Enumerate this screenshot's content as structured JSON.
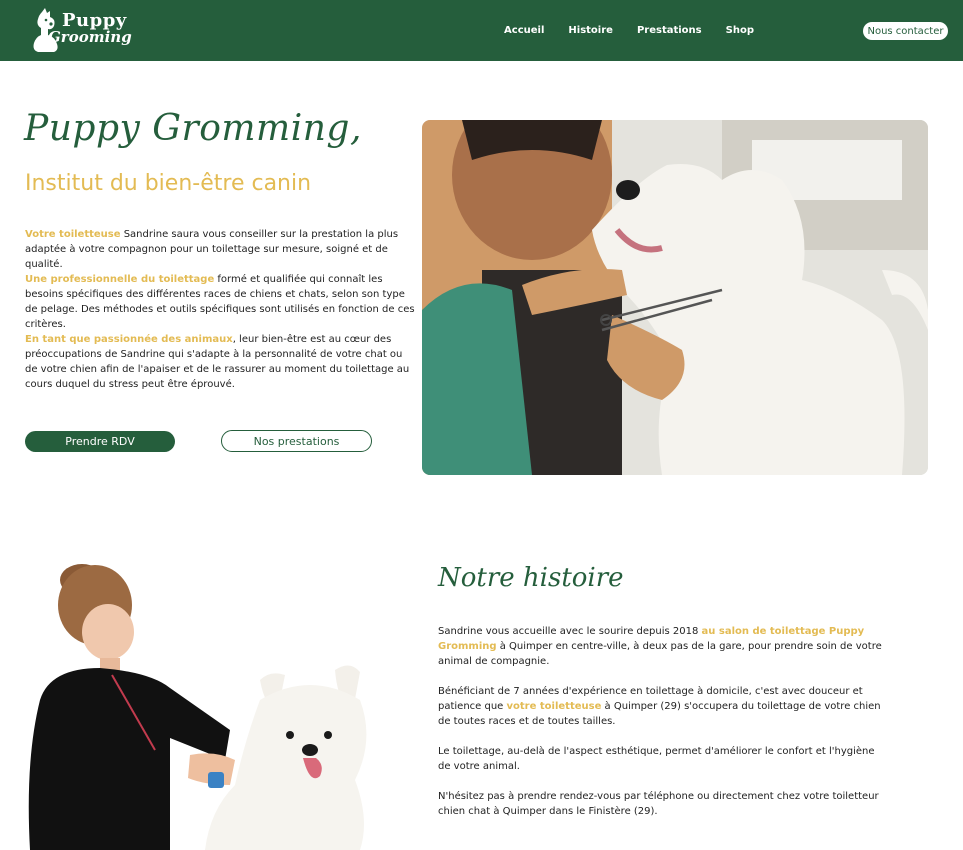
{
  "brand": {
    "name_top": "Puppy",
    "name_bottom": "Grooming"
  },
  "nav": {
    "links": [
      "Accueil",
      "Histoire",
      "Prestations",
      "Shop"
    ],
    "contact": "Nous contacter"
  },
  "hero": {
    "title": "Puppy Gromming,",
    "subtitle": "Institut du bien-être canin",
    "p1_hl": "Votre toiletteuse",
    "p1_rest": " Sandrine saura vous conseiller sur la prestation la plus adaptée à votre compagnon pour un toilettage sur mesure, soigné et de qualité.",
    "p2_hl": "Une professionnelle du toilettage",
    "p2_rest": " formé et qualifiée qui connaît les besoins spécifiques des différentes races de chiens et chats, selon son type de pelage. Des méthodes et outils spécifiques sont utilisés en fonction de ces critères.",
    "p3_hl": "En tant que passionnée des animaux",
    "p3_rest": ", leur bien-être est au cœur des préoccupations de Sandrine qui s'adapte à la personnalité de votre chat ou de votre chien afin de l'apaiser et de le rassurer au moment du toilettage au cours duquel du stress peut être éprouvé.",
    "btn_rdv": "Prendre RDV",
    "btn_prestations": "Nos prestations"
  },
  "story": {
    "title": "Notre histoire",
    "p1_a": "Sandrine vous accueille avec le sourire depuis 2018 ",
    "p1_hl": "au salon de toilettage  Puppy Gromming",
    "p1_b": " à Quimper en centre-ville, à deux pas de la gare, pour prendre soin de votre animal de compagnie.",
    "p2_a": "Bénéficiant de 7 années d'expérience en toilettage à domicile, c'est avec douceur et patience que ",
    "p2_hl": "votre toiletteuse",
    "p2_b": " à Quimper (29) s'occupera du toilettage de votre chien  de toutes races et de toutes tailles.",
    "p3": "Le toilettage, au-delà de l'aspect esthétique, permet d'améliorer le confort et l'hygiène de votre animal.",
    "p4": "N'hésitez pas à prendre rendez-vous par téléphone ou directement chez votre toiletteur chien chat à Quimper dans le Finistère (29)."
  },
  "colors": {
    "primary": "#255e3c",
    "accent": "#e3bb53",
    "background": "#ffffff"
  }
}
